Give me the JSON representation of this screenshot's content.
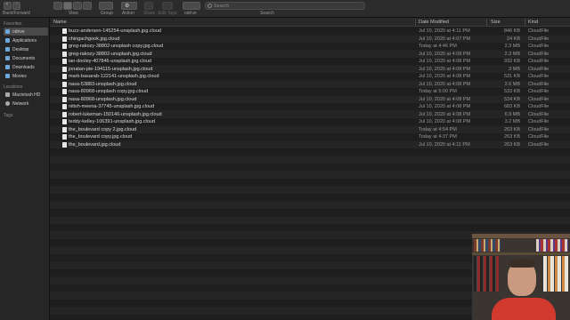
{
  "toolbar": {
    "nav_label": "Back/Forward",
    "view_label": "View",
    "group_label": "Group",
    "action_label": "Action",
    "share_label": "Share",
    "edit_tags_label": "Edit Tags",
    "location_label": "odrive",
    "search_label": "Search",
    "search_placeholder": "Search"
  },
  "sidebar": {
    "favorites_heading": "Favorites",
    "favorites": [
      "odrive",
      "Applications",
      "Desktop",
      "Documents",
      "Downloads",
      "Movies"
    ],
    "locations_heading": "Locations",
    "locations": [
      "Macintosh HD",
      "Network"
    ],
    "tags_heading": "Tags"
  },
  "columns": {
    "name": "Name",
    "date": "Date Modified",
    "size": "Size",
    "kind": "Kind"
  },
  "files": [
    {
      "name": "buzz-andersen-145254-unsplash.jpg.cloud",
      "date": "Jul 10, 2020 at 4:11 PM",
      "size": "846 KB",
      "kind": "CloudFile"
    },
    {
      "name": "chingachgook.jpg.cloud",
      "date": "Jul 10, 2020 at 4:07 PM",
      "size": "24 KB",
      "kind": "CloudFile"
    },
    {
      "name": "greg-rakozy-38802-unsplash copy.jpg.cloud",
      "date": "Today at 4:46 PM",
      "size": "2.3 MB",
      "kind": "CloudFile"
    },
    {
      "name": "greg-rakozy-38802-unsplash.jpg.cloud",
      "date": "Jul 10, 2020 at 4:08 PM",
      "size": "2.3 MB",
      "kind": "CloudFile"
    },
    {
      "name": "ian-dooley-407846-unsplash.jpg.cloud",
      "date": "Jul 10, 2020 at 4:08 PM",
      "size": "932 KB",
      "kind": "CloudFile"
    },
    {
      "name": "jonatan-pie-194115-unsplash.jpg.cloud",
      "date": "Jul 10, 2020 at 4:08 PM",
      "size": "3 MB",
      "kind": "CloudFile"
    },
    {
      "name": "mark-basarab-122141-unsplash.jpg.cloud",
      "date": "Jul 10, 2020 at 4:08 PM",
      "size": "531 KB",
      "kind": "CloudFile"
    },
    {
      "name": "nasa-53883-unsplash.jpg.cloud",
      "date": "Jul 10, 2020 at 4:08 PM",
      "size": "2.6 MB",
      "kind": "CloudFile"
    },
    {
      "name": "nasa-80968-unsplash copy.jpg.cloud",
      "date": "Today at 5:00 PM",
      "size": "533 KB",
      "kind": "CloudFile"
    },
    {
      "name": "nasa-80968-unsplash.jpg.cloud",
      "date": "Jul 10, 2020 at 4:08 PM",
      "size": "534 KB",
      "kind": "CloudFile"
    },
    {
      "name": "nitish-meena-37745-unsplash.jpg.cloud",
      "date": "Jul 10, 2020 at 4:08 PM",
      "size": "683 KB",
      "kind": "CloudFile"
    },
    {
      "name": "robert-lukeman-150146-unsplash.jpg.cloud",
      "date": "Jul 10, 2020 at 4:08 PM",
      "size": "6.9 MB",
      "kind": "CloudFile"
    },
    {
      "name": "teddy-kelley-106391-unsplash.jpg.cloud",
      "date": "Jul 10, 2020 at 4:08 PM",
      "size": "3.2 MB",
      "kind": "CloudFile"
    },
    {
      "name": "the_boulevard copy 2.jpg.cloud",
      "date": "Today at 4:54 PM",
      "size": "263 KB",
      "kind": "CloudFile"
    },
    {
      "name": "the_boulevard copy.jpg.cloud",
      "date": "Today at 4:37 PM",
      "size": "263 KB",
      "kind": "CloudFile"
    },
    {
      "name": "the_boulevard.jpg.cloud",
      "date": "Jul 10, 2020 at 4:11 PM",
      "size": "263 KB",
      "kind": "CloudFile"
    }
  ],
  "colors": {
    "window_bg": "#1e1e1e",
    "stripe_bg": "#252525",
    "sidebar_bg": "#262626",
    "folder_icon": "#6fa8dc",
    "webcam_shirt": "#d23a2e"
  }
}
